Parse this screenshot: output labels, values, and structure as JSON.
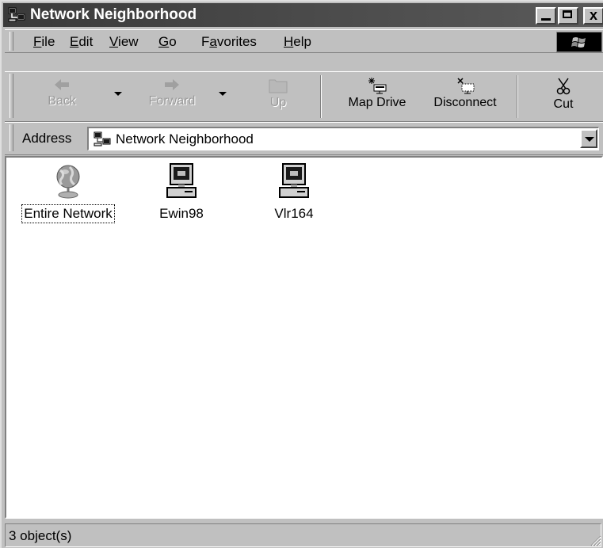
{
  "window": {
    "title": "Network Neighborhood",
    "controls": {
      "minimize": "minimize-icon",
      "maximize": "maximize-icon",
      "close_label": "x"
    }
  },
  "menu": {
    "items": [
      {
        "label": "File",
        "accel": "F",
        "rest": "ile"
      },
      {
        "label": "Edit",
        "accel": "E",
        "rest": "dit"
      },
      {
        "label": "View",
        "accel": "V",
        "rest": "iew"
      },
      {
        "label": "Go",
        "accel": "G",
        "rest": "o"
      },
      {
        "label": "Favorites",
        "pre": "F",
        "accel": "a",
        "rest": "vorites"
      },
      {
        "label": "Help",
        "accel": "H",
        "rest": "elp"
      }
    ]
  },
  "toolbar": {
    "buttons": [
      {
        "label": "Back",
        "icon": "back-arrow-icon",
        "enabled": false
      },
      {
        "label": "Forward",
        "icon": "forward-arrow-icon",
        "enabled": false
      },
      {
        "label": "Up",
        "icon": "folder-up-icon",
        "enabled": false
      },
      {
        "label": "Map Drive",
        "icon": "map-drive-icon",
        "enabled": true
      },
      {
        "label": "Disconnect",
        "icon": "disconnect-icon",
        "enabled": true
      },
      {
        "label": "Cut",
        "icon": "scissors-icon",
        "enabled": true
      }
    ]
  },
  "address": {
    "label": "Address",
    "value": "Network Neighborhood"
  },
  "content": {
    "items": [
      {
        "label": "Entire Network",
        "icon": "globe-icon",
        "focused": true
      },
      {
        "label": "Ewin98",
        "icon": "computer-icon",
        "focused": false
      },
      {
        "label": "Vlr164",
        "icon": "computer-icon",
        "focused": false
      }
    ]
  },
  "status": {
    "text": "3 object(s)"
  }
}
